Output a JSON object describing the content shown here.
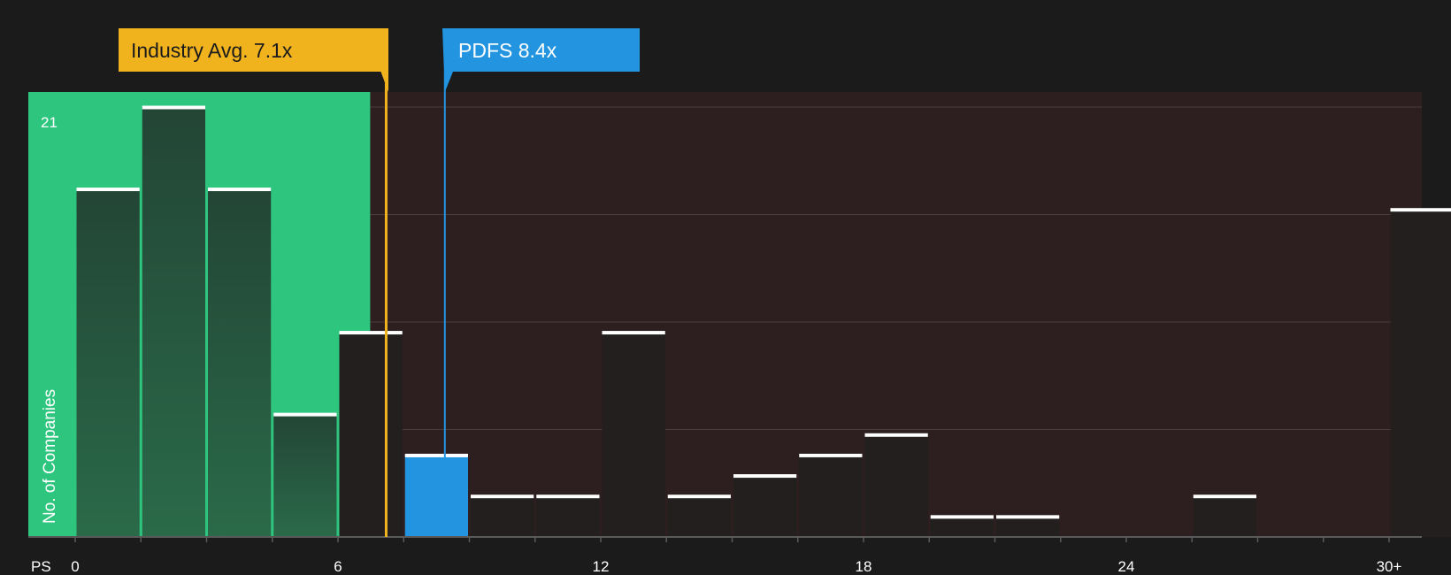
{
  "chart_data": {
    "type": "bar",
    "xlabel": "PS",
    "ylabel": "No. of Companies",
    "y_top_label": "21",
    "ylim": [
      0,
      21
    ],
    "x_ticks": [
      "0",
      "6",
      "12",
      "18",
      "24",
      "30+"
    ],
    "x_tick_values": [
      0,
      6,
      12,
      18,
      24,
      30
    ],
    "bin_width": 1.5,
    "bins": [
      {
        "x0": 0.0,
        "value": 17
      },
      {
        "x0": 1.5,
        "value": 21
      },
      {
        "x0": 3.0,
        "value": 17
      },
      {
        "x0": 4.5,
        "value": 6
      },
      {
        "x0": 6.0,
        "value": 10
      },
      {
        "x0": 7.5,
        "value": 4,
        "highlight": true
      },
      {
        "x0": 9.0,
        "value": 2
      },
      {
        "x0": 10.5,
        "value": 2
      },
      {
        "x0": 12.0,
        "value": 10
      },
      {
        "x0": 13.5,
        "value": 2
      },
      {
        "x0": 15.0,
        "value": 3
      },
      {
        "x0": 16.5,
        "value": 4
      },
      {
        "x0": 18.0,
        "value": 5
      },
      {
        "x0": 19.5,
        "value": 1
      },
      {
        "x0": 21.0,
        "value": 1
      },
      {
        "x0": 22.5,
        "value": 0
      },
      {
        "x0": 24.0,
        "value": 0
      },
      {
        "x0": 25.5,
        "value": 2
      },
      {
        "x0": 27.0,
        "value": 0
      },
      {
        "x0": 28.5,
        "value": 0
      },
      {
        "x0": 30.0,
        "value": 16
      }
    ],
    "industry_avg": {
      "label": "Industry Avg. 7.1x",
      "value": 7.1
    },
    "company": {
      "label": "PDFS 8.4x",
      "value": 8.4
    },
    "colors": {
      "background": "#1b1b1c",
      "undervalued_zone": "#2ec67e",
      "overvalued_zone": "#2d1e1f",
      "bar_in_green": "#234535",
      "bar_dark": "#231f1f",
      "bar_top": "#ffffff",
      "industry_color": "#f0b31e",
      "company_color": "#2394df",
      "gridline": "#4a3c3d"
    }
  }
}
